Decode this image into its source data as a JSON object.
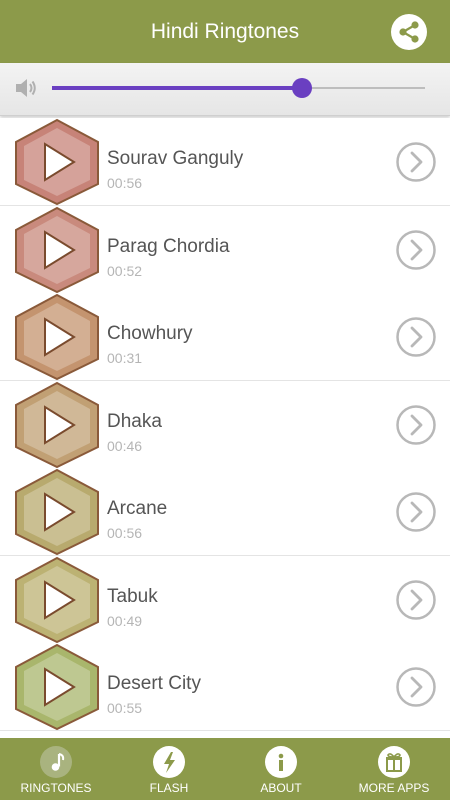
{
  "header": {
    "title": "Hindi Ringtones",
    "share_icon": "share-icon"
  },
  "volume": {
    "level": 0.67,
    "accent_color": "#6a3fc1",
    "icon": "speaker-icon"
  },
  "songs": [
    {
      "title": "Sourav Ganguly",
      "duration": "00:56",
      "color": "#c78378"
    },
    {
      "title": "Parag Chordia",
      "duration": "00:52",
      "color": "#c98a7d"
    },
    {
      "title": "Chowhury",
      "duration": "00:31",
      "color": "#c4946f"
    },
    {
      "title": "Dhaka",
      "duration": "00:46",
      "color": "#c1a074"
    },
    {
      "title": "Arcane",
      "duration": "00:56",
      "color": "#b8aa6e"
    },
    {
      "title": "Tabuk",
      "duration": "00:49",
      "color": "#bcb273"
    },
    {
      "title": "Desert City",
      "duration": "00:55",
      "color": "#a9b66c"
    }
  ],
  "bottom_nav": [
    {
      "label": "RINGTONES",
      "icon": "music-note-icon",
      "active": true
    },
    {
      "label": "FLASH",
      "icon": "flash-icon",
      "active": false
    },
    {
      "label": "ABOUT",
      "icon": "info-icon",
      "active": false
    },
    {
      "label": "MORE APPS",
      "icon": "gift-icon",
      "active": false
    }
  ],
  "colors": {
    "brand": "#8c9a4a",
    "text": "#555555",
    "subtext": "#b5b5b5"
  }
}
